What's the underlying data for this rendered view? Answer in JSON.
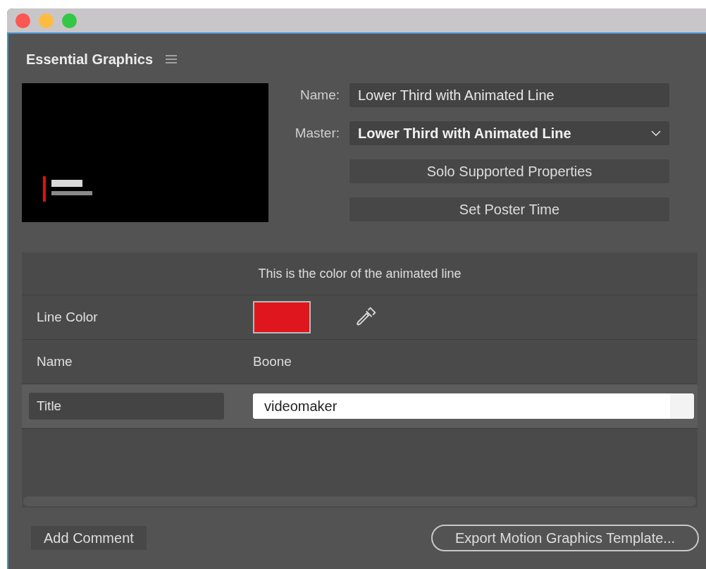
{
  "panel": {
    "title": "Essential Graphics"
  },
  "template": {
    "name_label": "Name:",
    "name_value": "Lower Third with Animated Line",
    "master_label": "Master:",
    "master_value": "Lower Third with Animated Line",
    "buttons": [
      "Solo Supported Properties",
      "Set Poster Time"
    ]
  },
  "properties": {
    "description": "This is the color of the animated line",
    "rows": [
      {
        "kind": "color",
        "label": "Line Color",
        "color": "#e0161e",
        "selected": false
      },
      {
        "kind": "text",
        "label": "Name",
        "value": "Boone",
        "selected": false
      },
      {
        "kind": "input",
        "label": "Title",
        "value": "videomaker",
        "selected": true
      }
    ]
  },
  "footer": {
    "add_comment": "Add Comment",
    "export": "Export Motion Graphics Template..."
  }
}
